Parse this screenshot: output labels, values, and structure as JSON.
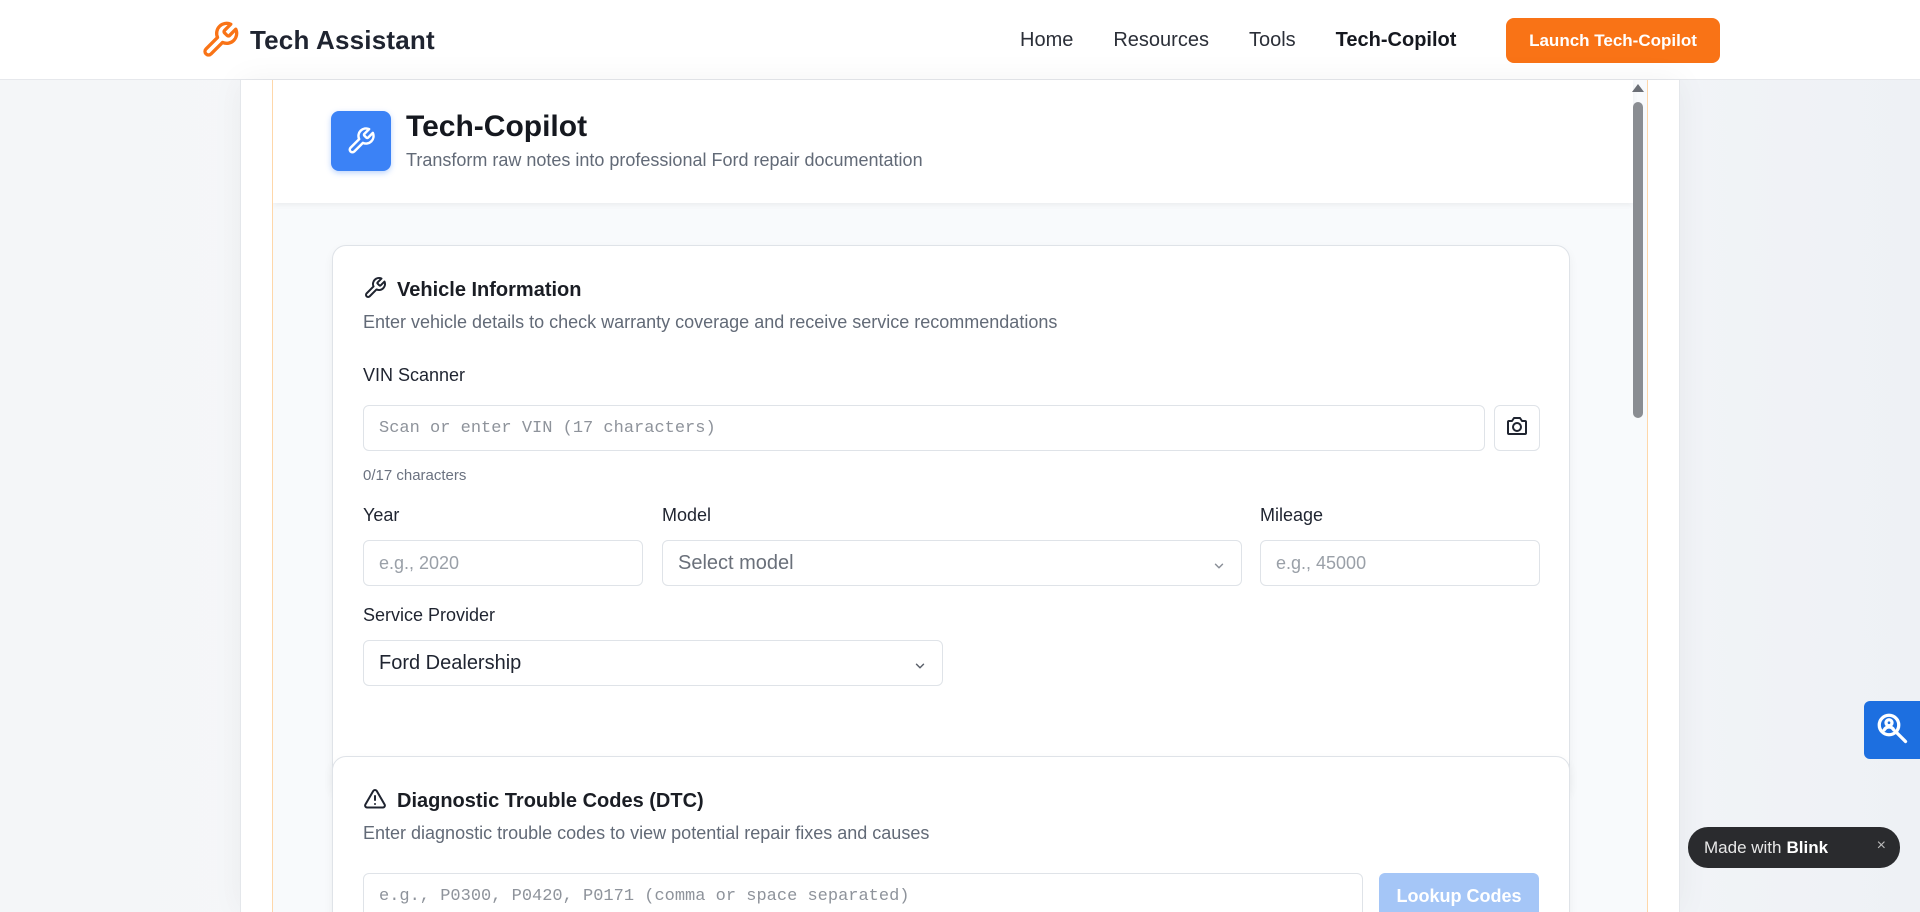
{
  "nav": {
    "brand": "Tech Assistant",
    "links": [
      "Home",
      "Resources",
      "Tools",
      "Tech-Copilot"
    ],
    "active": "Tech-Copilot",
    "cta": "Launch Tech-Copilot",
    "accent": "#f97316"
  },
  "header": {
    "title": "Tech-Copilot",
    "subtitle": "Transform raw notes into professional Ford repair documentation",
    "icon": "wrench-icon",
    "icon_color": "#3b82f6"
  },
  "vehicle": {
    "title": "Vehicle Information",
    "description": "Enter vehicle details to check warranty coverage and receive service recommendations",
    "vin_label": "VIN Scanner",
    "vin_placeholder": "Scan or enter VIN (17 characters)",
    "vin_counter": "0/17 characters",
    "year_label": "Year",
    "year_placeholder": "e.g., 2020",
    "model_label": "Model",
    "model_value": "Select model",
    "mileage_label": "Mileage",
    "mileage_placeholder": "e.g., 45000",
    "provider_label": "Service Provider",
    "provider_value": "Ford Dealership"
  },
  "dtc": {
    "title": "Diagnostic Trouble Codes (DTC)",
    "description": "Enter diagnostic trouble codes to view potential repair fixes and causes",
    "placeholder": "e.g., P0300, P0420, P0171 (comma or space separated)",
    "button": "Lookup Codes"
  },
  "badge": {
    "prefix": "Made with",
    "brand": "Blink",
    "close": "×"
  }
}
